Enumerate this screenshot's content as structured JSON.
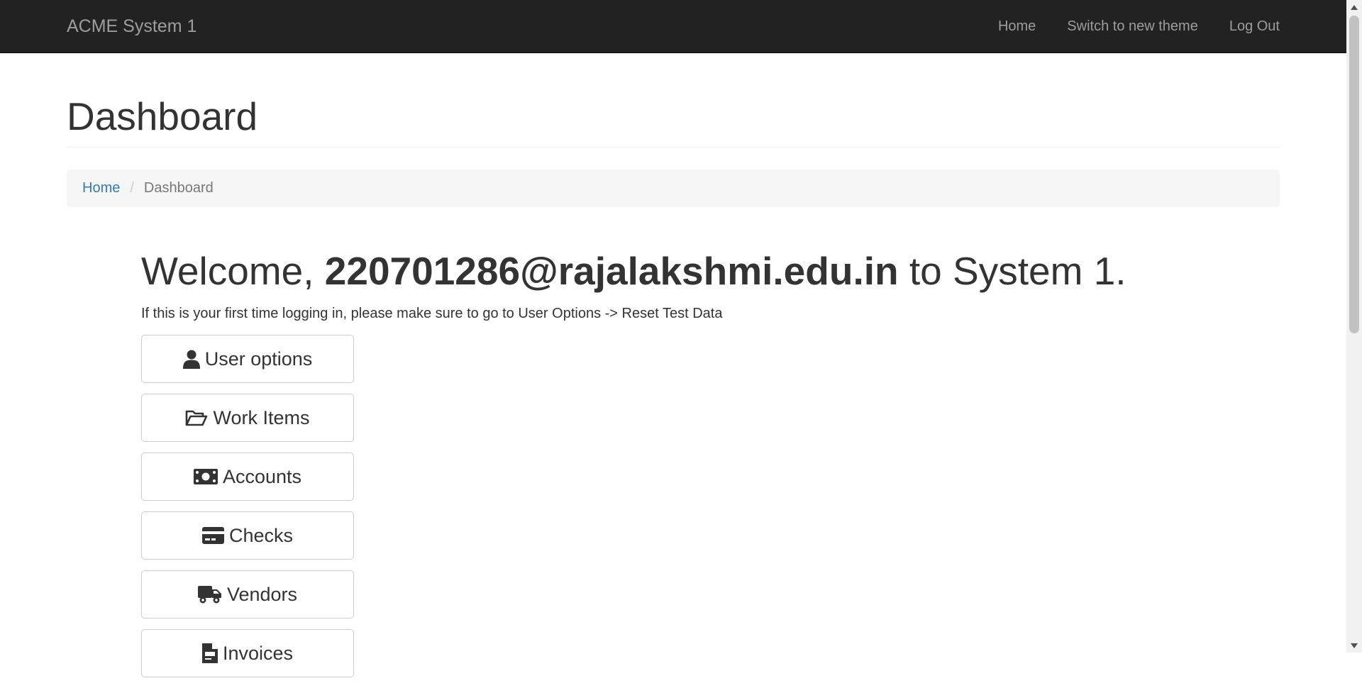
{
  "navbar": {
    "brand": "ACME System 1",
    "links": [
      "Home",
      "Switch to new theme",
      "Log Out"
    ]
  },
  "header": {
    "title": "Dashboard"
  },
  "breadcrumb": {
    "home": "Home",
    "separator": "/",
    "current": "Dashboard"
  },
  "welcome": {
    "prefix": "Welcome, ",
    "user": "220701286@rajalakshmi.edu.in",
    "suffix": " to System 1.",
    "hint": "If this is your first time logging in, please make sure to go to User Options -> Reset Test Data"
  },
  "menu": {
    "items": [
      {
        "label": "User options",
        "icon": "user-icon"
      },
      {
        "label": "Work Items",
        "icon": "folder-open-icon"
      },
      {
        "label": "Accounts",
        "icon": "money-bill-icon"
      },
      {
        "label": "Checks",
        "icon": "credit-card-icon"
      },
      {
        "label": "Vendors",
        "icon": "truck-icon"
      },
      {
        "label": "Invoices",
        "icon": "file-invoice-icon"
      }
    ]
  },
  "colors": {
    "navbar_bg": "#222222",
    "navbar_text": "#9d9d9d",
    "link": "#337ab7",
    "breadcrumb_bg": "#f5f5f5",
    "text": "#333333"
  }
}
